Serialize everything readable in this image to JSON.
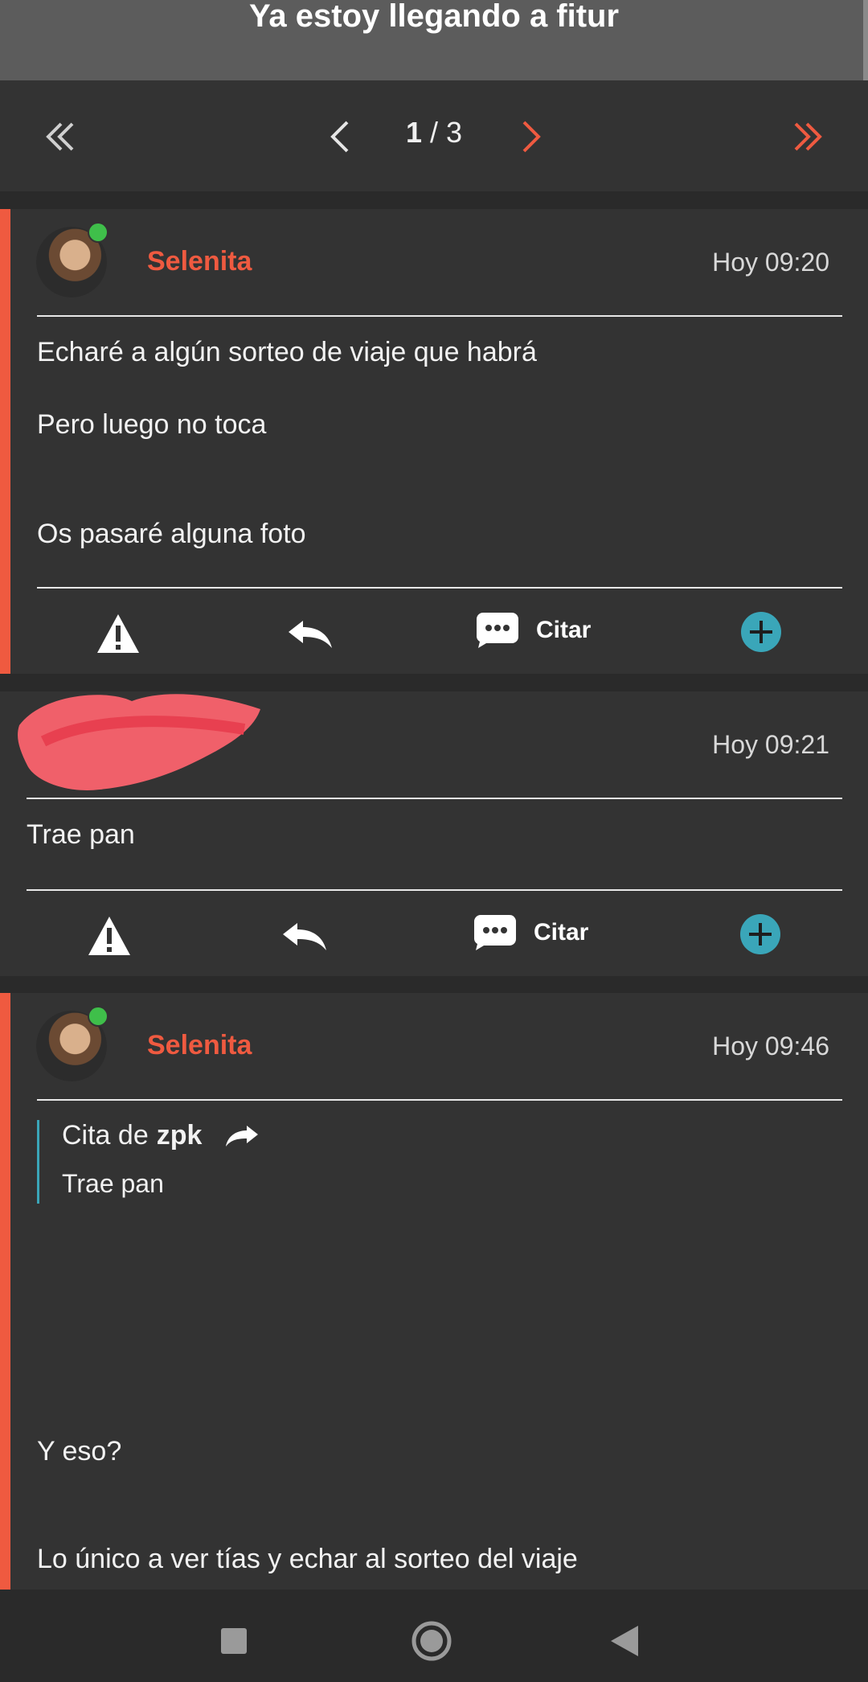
{
  "header": {
    "title": "Ya estoy llegando a fitur"
  },
  "pager": {
    "current": "1",
    "separator": "/ 3",
    "first_icon": "double-chevron-left-icon",
    "prev_icon": "chevron-left-icon",
    "next_icon": "chevron-right-icon",
    "last_icon": "double-chevron-right-icon"
  },
  "colors": {
    "accent": "#ef5a40",
    "teal": "#3aa6b9",
    "online": "#3fbf4a",
    "background": "#333333"
  },
  "posts": [
    {
      "author": "Selenita",
      "time": "Hoy 09:20",
      "lines": [
        "Echaré a algún sorteo de viaje que habrá",
        "Pero luego no toca",
        "Os pasaré alguna foto"
      ],
      "actions": {
        "quote_label": "Citar"
      }
    },
    {
      "author": "",
      "time": "Hoy 09:21",
      "lines": [
        "Trae pan"
      ],
      "actions": {
        "quote_label": "Citar"
      }
    },
    {
      "author": "Selenita",
      "time": "Hoy 09:46",
      "quote": {
        "prefix": "Cita de",
        "user": "zpk",
        "text": "Trae pan"
      },
      "lines": [
        "Y eso?",
        "Lo único a ver tías y echar al sorteo del viaje"
      ]
    }
  ],
  "navbar": {
    "icons": [
      "square-icon",
      "home-circle-icon",
      "back-triangle-icon"
    ]
  }
}
